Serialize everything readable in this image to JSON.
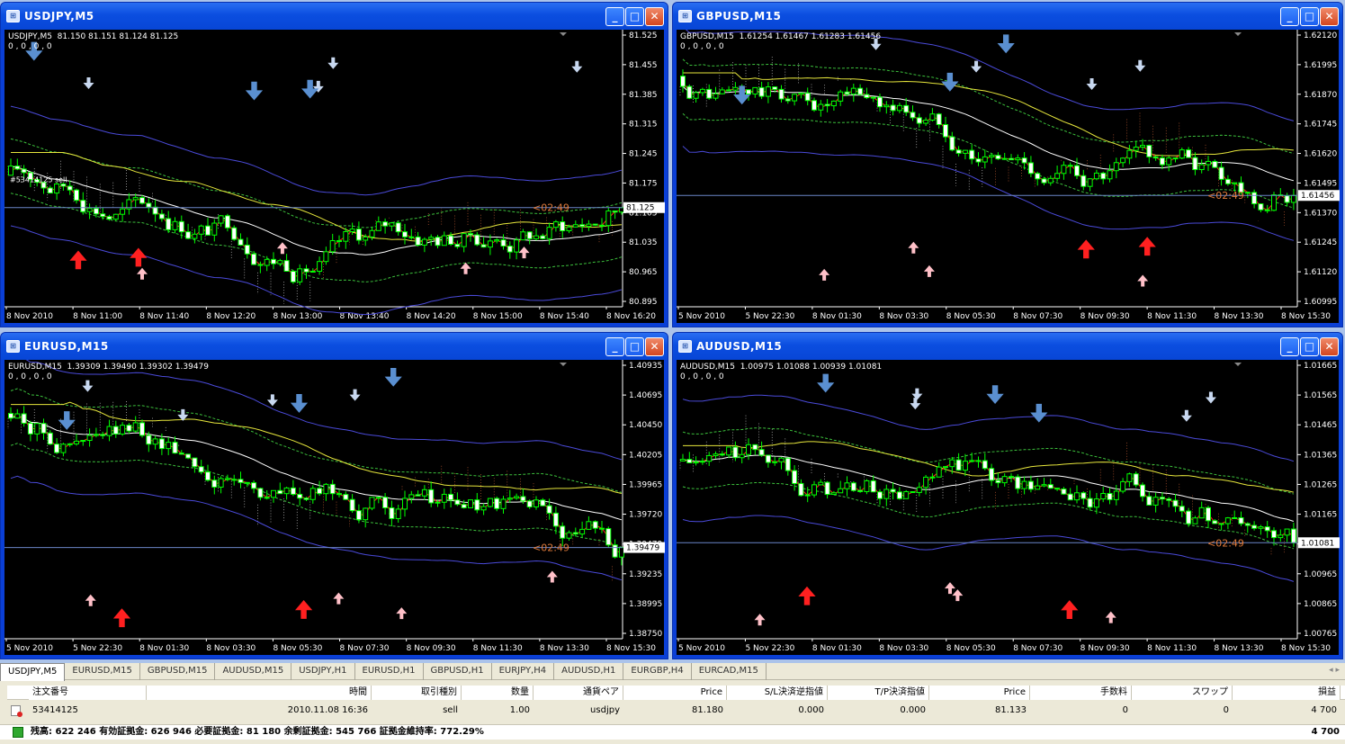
{
  "windows": [
    {
      "id": "w1",
      "title": "USDJPY,M5",
      "ohlc": "USDJPY,M5  81.150 81.151 81.124 81.125",
      "ind": "0 , 0 , 0 , 0",
      "ticket": "#53414125 sell",
      "countdown": "<02:49",
      "bid": "81.125",
      "prices": [
        "81.525",
        "81.455",
        "81.385",
        "81.315",
        "81.245",
        "81.175",
        "81.105",
        "81.035",
        "80.965",
        "80.895"
      ],
      "times": [
        "8 Nov 2010",
        "8 Nov 11:00",
        "8 Nov 11:40",
        "8 Nov 12:20",
        "8 Nov 13:00",
        "8 Nov 13:40",
        "8 Nov 14:20",
        "8 Nov 15:00",
        "8 Nov 15:40",
        "8 Nov 16:20"
      ],
      "range": [
        80.895,
        81.525
      ],
      "last": 81.125,
      "start": 81.2
    },
    {
      "id": "w2",
      "title": "GBPUSD,M15",
      "ohlc": "GBPUSD,M15  1.61254 1.61467 1.61283 1.61456",
      "ind": "0 , 0 , 0 , 0",
      "ticket": "",
      "countdown": "<02:49",
      "bid": "1.61456",
      "prices": [
        "1.62120",
        "1.61995",
        "1.61870",
        "1.61745",
        "1.61620",
        "1.61495",
        "1.61370",
        "1.61245",
        "1.61120",
        "1.60995"
      ],
      "times": [
        "5 Nov 2010",
        "5 Nov 22:30",
        "8 Nov 01:30",
        "8 Nov 03:30",
        "8 Nov 05:30",
        "8 Nov 07:30",
        "8 Nov 09:30",
        "8 Nov 11:30",
        "8 Nov 13:30",
        "8 Nov 15:30"
      ],
      "range": [
        1.60995,
        1.6212
      ],
      "last": 1.61456,
      "start": 1.6195
    },
    {
      "id": "w3",
      "title": "EURUSD,M15",
      "ohlc": "EURUSD,M15  1.39309 1.39490 1.39302 1.39479",
      "ind": "0 , 0 , 0 , 0",
      "ticket": "",
      "countdown": "<02:49",
      "bid": "1.39479",
      "prices": [
        "1.40935",
        "1.40695",
        "1.40450",
        "1.40205",
        "1.39965",
        "1.39720",
        "1.39479",
        "1.39235",
        "1.38995",
        "1.38750"
      ],
      "times": [
        "5 Nov 2010",
        "5 Nov 22:30",
        "8 Nov 01:30",
        "8 Nov 03:30",
        "8 Nov 05:30",
        "8 Nov 07:30",
        "8 Nov 09:30",
        "8 Nov 11:30",
        "8 Nov 13:30",
        "8 Nov 15:30"
      ],
      "range": [
        1.3875,
        1.40935
      ],
      "last": 1.39479,
      "start": 1.4055
    },
    {
      "id": "w4",
      "title": "AUDUSD,M15",
      "ohlc": "AUDUSD,M15  1.00975 1.01088 1.00939 1.01081",
      "ind": "0 , 0 , 0 , 0",
      "ticket": "",
      "countdown": "<02:49",
      "bid": "1.01081",
      "prices": [
        "1.01665",
        "1.01565",
        "1.01465",
        "1.01365",
        "1.01265",
        "1.01165",
        "1.01081",
        "1.00965",
        "1.00865",
        "1.00765"
      ],
      "times": [
        "5 Nov 2010",
        "5 Nov 22:30",
        "8 Nov 01:30",
        "8 Nov 03:30",
        "8 Nov 05:30",
        "8 Nov 07:30",
        "8 Nov 09:30",
        "8 Nov 11:30",
        "8 Nov 13:30",
        "8 Nov 15:30"
      ],
      "range": [
        1.00765,
        1.01665
      ],
      "last": 1.01081,
      "start": 1.0135
    }
  ],
  "tabs": [
    "USDJPY,M5",
    "EURUSD,M15",
    "GBPUSD,M15",
    "AUDUSD,M15",
    "USDJPY,H1",
    "EURUSD,H1",
    "GBPUSD,H1",
    "EURJPY,H4",
    "AUDUSD,H1",
    "EURGBP,H4",
    "EURCAD,M15"
  ],
  "table": {
    "headers": [
      "注文番号",
      "時間",
      "取引種別",
      "数量",
      "通貨ペア",
      "Price",
      "S/L決済逆指値",
      "T/P決済指値",
      "Price",
      "手数料",
      "スワップ",
      "損益"
    ],
    "row": [
      "53414125",
      "2010.11.08 16:36",
      "sell",
      "1.00",
      "usdjpy",
      "81.180",
      "0.000",
      "0.000",
      "81.133",
      "0",
      "0",
      "4 700"
    ]
  },
  "summary": {
    "text": "残高: 622 246  有効証拠金: 626 946  必要証拠金: 81 180  余剰証拠金: 545 766  証拠金維持率: 772.29%",
    "profit": "4 700"
  },
  "colors": {
    "up": "#00ff00",
    "down": "#ffffff",
    "bull_candle": "#000000",
    "grid": "#3a3a3a",
    "bid_line": "#6b86c7",
    "arrow_up": "#ff2020",
    "arrow_down": "#5a8fd0"
  }
}
